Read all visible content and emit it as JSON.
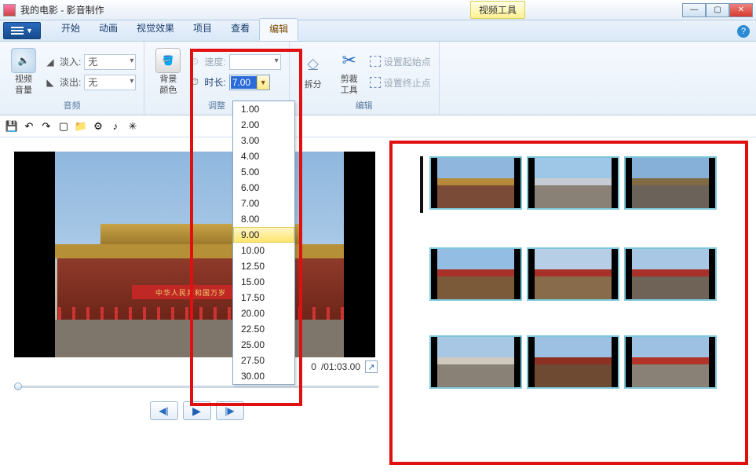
{
  "title": "我的电影 - 影音制作",
  "contextual_tab": "视频工具",
  "window_controls": {
    "min": "—",
    "max": "▢",
    "close": "✕"
  },
  "tabs": {
    "items": [
      "开始",
      "动画",
      "视觉效果",
      "项目",
      "查看",
      "编辑"
    ],
    "active_index": 5
  },
  "help_icon": "?",
  "ribbon": {
    "audio": {
      "big_label": "视频\n音量",
      "fade_in_label": "淡入:",
      "fade_in_value": "无",
      "fade_out_label": "淡出:",
      "fade_out_value": "无",
      "group_label": "音频"
    },
    "adjust": {
      "big_label": "背景\n颜色",
      "speed_label": "速度:",
      "speed_value": "",
      "duration_icon": "⏱",
      "duration_label": "时长:",
      "duration_value": "7.00",
      "group_label": "调整"
    },
    "edit": {
      "split_big": "拆分",
      "trim_big": "剪裁\n工具",
      "set_start": "设置起始点",
      "set_end": "设置终止点",
      "group_label": "编辑"
    }
  },
  "duration_options": [
    "1.00",
    "2.00",
    "3.00",
    "4.00",
    "5.00",
    "6.00",
    "7.00",
    "8.00",
    "9.00",
    "10.00",
    "12.50",
    "15.00",
    "17.50",
    "20.00",
    "22.50",
    "25.00",
    "27.50",
    "30.00"
  ],
  "duration_highlight_index": 8,
  "qat": {
    "save": "💾",
    "undo": "↶",
    "redo": "↷",
    "new": "▢",
    "folder": "📁",
    "gear": "⚙",
    "note": "♪",
    "sparkle": "✳"
  },
  "preview": {
    "banner_text": "中华人民共和国万岁",
    "time_left": "0",
    "time_total": "/01:03.00",
    "expand": "↗"
  },
  "transport": {
    "prev": "◀|",
    "play": "▶",
    "next": "|▶"
  },
  "thumbnails": {
    "rows": [
      [
        {
          "sky": "#8fb7de",
          "ground": "#7a4b36",
          "mid": "#b48a3a"
        },
        {
          "sky": "#9ec6e6",
          "ground": "#8a8176",
          "mid": "#c5ccd3"
        },
        {
          "sky": "#87b0d8",
          "ground": "#6b625a",
          "mid": "#7f6a42"
        }
      ],
      [
        {
          "sky": "#93bde2",
          "ground": "#7b5a3a",
          "mid": "#a73128"
        },
        {
          "sky": "#b7cfe6",
          "ground": "#876b4a",
          "mid": "#a73128"
        },
        {
          "sky": "#a7c7e4",
          "ground": "#6f6256",
          "mid": "#a73128"
        }
      ],
      [
        {
          "sky": "#a7c7e4",
          "ground": "#8a8176",
          "mid": "#cfcabd"
        },
        {
          "sky": "#9cc1e2",
          "ground": "#6f4a33",
          "mid": "#8e2f24"
        },
        {
          "sky": "#9cc1e2",
          "ground": "#8a8176",
          "mid": "#b23428"
        }
      ]
    ]
  }
}
